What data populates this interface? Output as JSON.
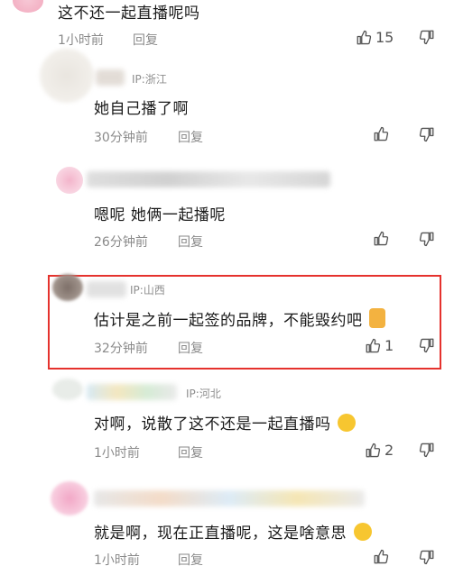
{
  "comments": [
    {
      "text": "这不还一起直播呢吗",
      "time": "1小时前",
      "reply": "回复",
      "likes": "15"
    },
    {
      "ip": "IP:浙江",
      "text": "她自己播了啊",
      "time": "30分钟前",
      "reply": "回复",
      "likes": ""
    },
    {
      "ip": "",
      "text": "嗯呢 她俩一起播呢",
      "time": "26分钟前",
      "reply": "回复",
      "likes": ""
    },
    {
      "ip": "IP:山西",
      "text": "估计是之前一起签的品牌，不能毁约吧",
      "time": "32分钟前",
      "reply": "回复",
      "likes": "1"
    },
    {
      "ip": "IP:河北",
      "text": "对啊，说散了这不还是一起直播吗",
      "time": "1小时前",
      "reply": "回复",
      "likes": "2"
    },
    {
      "ip": "",
      "text": "就是啊，现在正直播呢，这是啥意思",
      "time": "1小时前",
      "reply": "回复",
      "likes": ""
    }
  ],
  "icons": {
    "like": "thumbs-up-icon",
    "dislike": "thumbs-down-icon"
  },
  "colors": {
    "highlight": "#e5322d",
    "meta": "#8a8a8a"
  }
}
